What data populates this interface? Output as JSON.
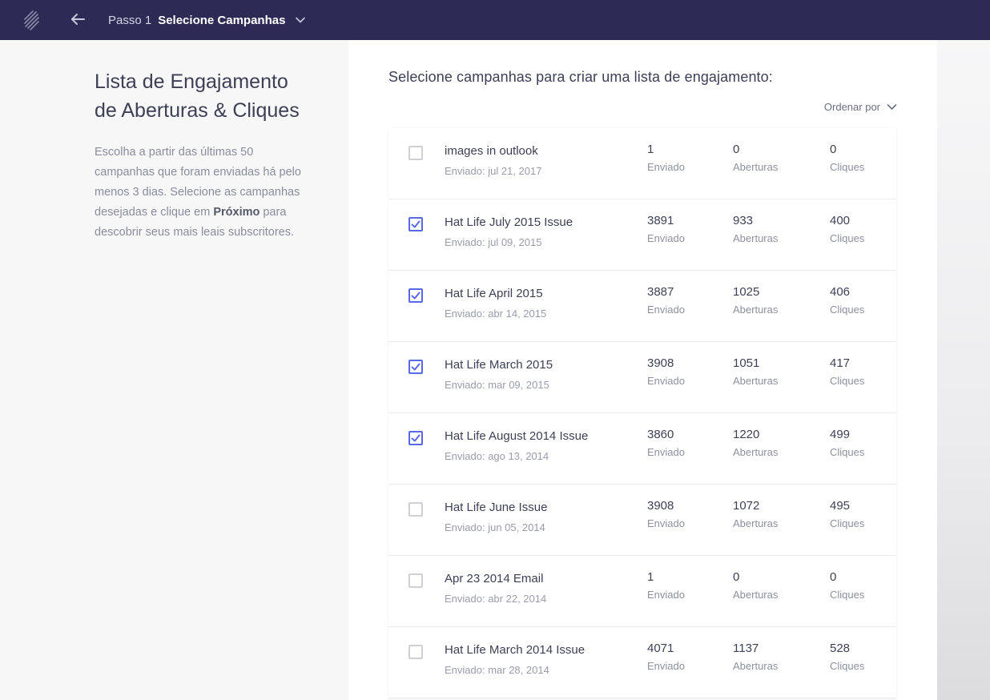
{
  "header": {
    "step_number": "Passo 1",
    "step_title": "Selecione Campanhas"
  },
  "intro": {
    "title": "Lista de Engajamento de Aberturas & Cliques",
    "description_before": "Escolha a partir das últimas 50 campanhas que foram enviadas há pelo menos 3 dias. Selecione as campanhas desejadas e clique em ",
    "description_bold": "Próximo",
    "description_after": " para descobrir seus mais leais subscritores."
  },
  "main": {
    "heading": "Selecione campanhas para criar uma lista de engajamento:",
    "sort_label": "Ordenar por"
  },
  "labels": {
    "sent": "Enviado",
    "opens": "Aberturas",
    "clicks": "Cliques"
  },
  "campaigns": [
    {
      "checked": false,
      "name": "images in outlook",
      "date": "Enviado: jul 21, 2017",
      "sent": "1",
      "opens": "0",
      "clicks": "0"
    },
    {
      "checked": true,
      "name": "Hat Life July 2015 Issue",
      "date": "Enviado: jul 09, 2015",
      "sent": "3891",
      "opens": "933",
      "clicks": "400"
    },
    {
      "checked": true,
      "name": "Hat Life April 2015",
      "date": "Enviado: abr 14, 2015",
      "sent": "3887",
      "opens": "1025",
      "clicks": "406"
    },
    {
      "checked": true,
      "name": "Hat Life March 2015",
      "date": "Enviado: mar 09, 2015",
      "sent": "3908",
      "opens": "1051",
      "clicks": "417"
    },
    {
      "checked": true,
      "name": "Hat Life August 2014 Issue",
      "date": "Enviado: ago 13, 2014",
      "sent": "3860",
      "opens": "1220",
      "clicks": "499"
    },
    {
      "checked": false,
      "name": "Hat Life June Issue",
      "date": "Enviado: jun 05, 2014",
      "sent": "3908",
      "opens": "1072",
      "clicks": "495"
    },
    {
      "checked": false,
      "name": "Apr 23 2014 Email",
      "date": "Enviado: abr 22, 2014",
      "sent": "1",
      "opens": "0",
      "clicks": "0"
    },
    {
      "checked": false,
      "name": "Hat Life March 2014 Issue",
      "date": "Enviado: mar 28, 2014",
      "sent": "4071",
      "opens": "1137",
      "clicks": "528"
    }
  ],
  "colors": {
    "topbar": "#2d2b55",
    "accent": "#5968e8"
  },
  "icons": {
    "logo": "brand-logo-icon",
    "back": "arrow-left-icon",
    "chevron": "chevron-down-icon",
    "check": "check-icon"
  }
}
